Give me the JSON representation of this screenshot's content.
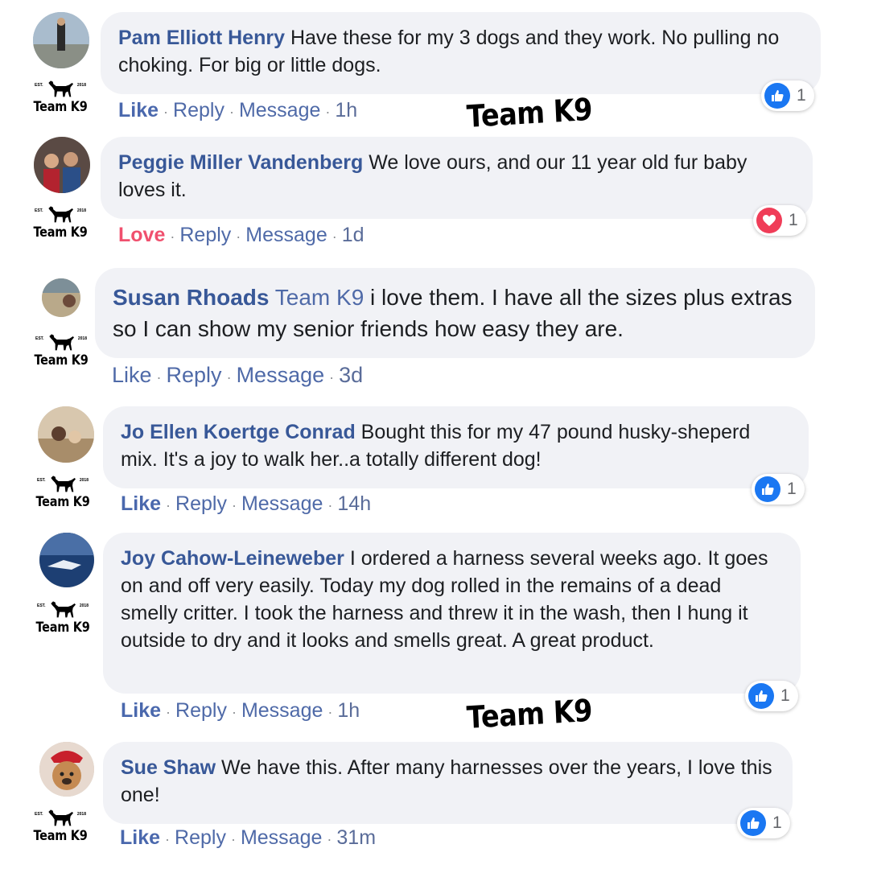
{
  "brand": {
    "name": "Team K9",
    "est_left": "EST.",
    "est_right": "2018"
  },
  "watermarks": [
    "Team K9",
    "Team K9"
  ],
  "comments": [
    {
      "author": "Pam Elliott Henry",
      "text": "Have these for my 3 dogs and they work. No pulling no choking. For big or little dogs.",
      "reaction_action": "Like",
      "reply": "Reply",
      "message": "Message",
      "time": "1h",
      "reaction_icon": "like-icon",
      "reaction_count": "1"
    },
    {
      "author": "Peggie Miller Vandenberg",
      "text": "We love ours, and our 11 year old fur baby loves it.",
      "reaction_action": "Love",
      "reply": "Reply",
      "message": "Message",
      "time": "1d",
      "reaction_icon": "love-icon",
      "reaction_count": "1"
    },
    {
      "author": "Susan Rhoads",
      "mention": "Team K9",
      "text": "i love them. I have all the sizes plus extras so I can show my senior friends how easy they are.",
      "reaction_action": "Like",
      "reply": "Reply",
      "message": "Message",
      "time": "3d"
    },
    {
      "author": "Jo Ellen Koertge Conrad",
      "text": "Bought this for my 47 pound husky-sheperd mix. It's a joy to walk her..a totally different dog!",
      "reaction_action": "Like",
      "reply": "Reply",
      "message": "Message",
      "time": "14h",
      "reaction_icon": "like-icon",
      "reaction_count": "1"
    },
    {
      "author": "Joy Cahow-Leineweber",
      "text": "I ordered a harness several weeks ago. It goes on and off very easily. Today my dog rolled in the remains of a dead smelly critter. I took the harness and threw it in the wash, then I hung it outside to dry and it looks and smells great. A great product.",
      "reaction_action": "Like",
      "reply": "Reply",
      "message": "Message",
      "time": "1h",
      "reaction_icon": "like-icon",
      "reaction_count": "1"
    },
    {
      "author": "Sue Shaw",
      "text": "We have this. After many harnesses over the years, I love this one!",
      "reaction_action": "Like",
      "reply": "Reply",
      "message": "Message",
      "time": "31m",
      "reaction_icon": "like-icon",
      "reaction_count": "1"
    }
  ],
  "colors": {
    "author_blue": "#385898",
    "link_blue": "#4f6aa8",
    "love_red": "#f0506e",
    "bubble_bg": "#f1f2f6",
    "like_badge": "#1a77f2",
    "love_badge": "#f03d58"
  }
}
